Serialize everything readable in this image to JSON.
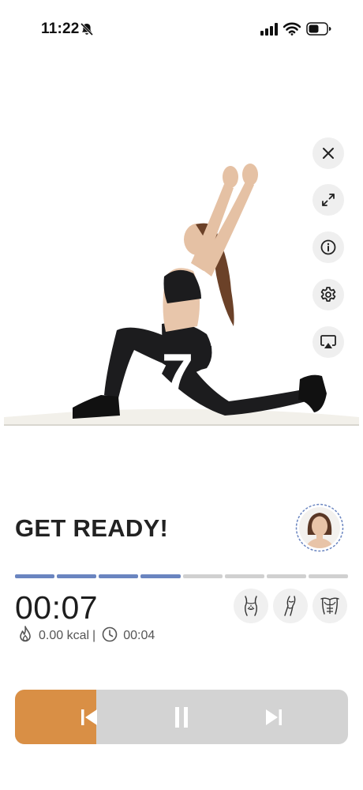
{
  "status_bar": {
    "time": "11:22",
    "icons": [
      "bell-slash-icon",
      "signal-icon",
      "wifi-icon",
      "battery-icon"
    ]
  },
  "media": {
    "countdown": "7",
    "buttons": [
      "close-icon",
      "expand-icon",
      "info-icon",
      "settings-icon",
      "airplay-icon"
    ]
  },
  "workout": {
    "title": "GET READY!",
    "progress_segments": 8,
    "progress_completed": 4,
    "timer": "00:07",
    "calories": "0.00 kcal",
    "separator": "|",
    "duration": "00:04",
    "muscle_icons": [
      "hip-muscle-icon",
      "leg-muscle-icon",
      "chest-muscle-icon"
    ]
  },
  "controls": {
    "progress_fraction": 0.245,
    "buttons": [
      "previous-icon",
      "pause-icon",
      "next-icon"
    ]
  },
  "colors": {
    "accent_orange": "#d98f45",
    "progress_blue": "#6a85c0",
    "control_gray": "#d3d3d3"
  }
}
